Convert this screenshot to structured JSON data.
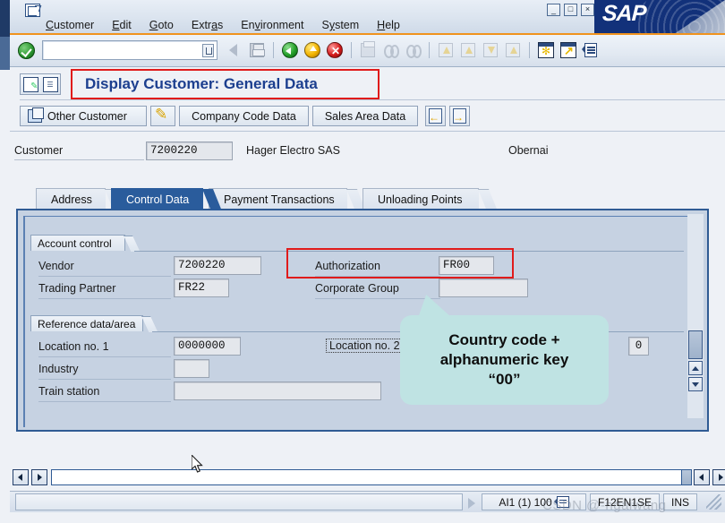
{
  "window": {
    "system_menu_icon": "sap-system-menu-icon",
    "minimize_label": "_",
    "maximize_label": "□",
    "close_label": "×",
    "logo_text": "SAP"
  },
  "menubar": {
    "items": [
      {
        "label": "Customer",
        "accel": "C"
      },
      {
        "label": "Edit",
        "accel": "E"
      },
      {
        "label": "Goto",
        "accel": "G"
      },
      {
        "label": "Extras",
        "accel": "a"
      },
      {
        "label": "Environment",
        "accel": "v"
      },
      {
        "label": "System",
        "accel": "y"
      },
      {
        "label": "Help",
        "accel": "H"
      }
    ]
  },
  "toolbar": {
    "ok_icon": "green-check-icon",
    "command_field_value": "",
    "command_field_placeholder": "",
    "command_dropdown_icon": "command-history-icon",
    "icons": [
      "back-arrow-icon",
      "save-icon",
      "back-green-icon",
      "exit-yellow-icon",
      "cancel-red-icon",
      "print-icon",
      "find-icon",
      "find-next-icon",
      "first-page-icon",
      "previous-page-icon",
      "next-page-icon",
      "last-page-icon",
      "new-session-icon",
      "create-shortcut-icon",
      "help-icon"
    ]
  },
  "title": {
    "text": "Display Customer: General Data",
    "app_icon_1": "customer-display-icon",
    "app_icon_2": "list-icon"
  },
  "appbar": {
    "buttons": [
      {
        "label": "Other Customer",
        "icon": "other-customer-icon"
      },
      {
        "label": "",
        "icon": "edit-pencil-icon"
      },
      {
        "label": "Company Code Data",
        "icon": ""
      },
      {
        "label": "Sales Area Data",
        "icon": ""
      }
    ],
    "nav_prev_icon": "previous-customer-icon",
    "nav_next_icon": "next-customer-icon",
    "nav_prev_arrow": "←",
    "nav_next_arrow": "→"
  },
  "customer_header": {
    "label": "Customer",
    "number": "7200220",
    "name": "Hager Electro SAS",
    "city": "Obernai"
  },
  "tabs": [
    {
      "label": "Address",
      "active": false
    },
    {
      "label": "Control Data",
      "active": true
    },
    {
      "label": "Payment Transactions",
      "active": false
    },
    {
      "label": "Unloading Points",
      "active": false
    }
  ],
  "account_control": {
    "group_title": "Account control",
    "fields": [
      {
        "label": "Vendor",
        "value": "7200220"
      },
      {
        "label": "Trading Partner",
        "value": "FR22"
      },
      {
        "label": "Authorization",
        "value": "FR00"
      },
      {
        "label": "Corporate Group",
        "value": ""
      }
    ]
  },
  "reference_data": {
    "group_title": "Reference data/area",
    "fields": [
      {
        "label": "Location no. 1",
        "value": "0000000"
      },
      {
        "label": "Location no. 2",
        "value": "0"
      },
      {
        "label": "Industry",
        "value": ""
      },
      {
        "label": "Train station",
        "value": ""
      }
    ]
  },
  "callout": {
    "line1": "Country code  +",
    "line2": "alphanumeric key",
    "line3": "“00”"
  },
  "statusbar": {
    "message": "",
    "system": "AI1 (1) 100",
    "server_icon": "server-info-icon",
    "session": "F12EN1SE",
    "insert_mode": "INS",
    "resize_grip": "resize-grip-icon"
  },
  "watermark": {
    "text": "CSDN @-ngaiwang"
  },
  "colors": {
    "accent_blue": "#2a5c9c",
    "title_blue": "#1c3f8f",
    "highlight_red": "#e01b1b",
    "callout_cyan": "#bfe3e3",
    "panel_bg": "#c6d2e2",
    "orange_rule": "#f0931e",
    "sap_navy": "#12317a"
  }
}
